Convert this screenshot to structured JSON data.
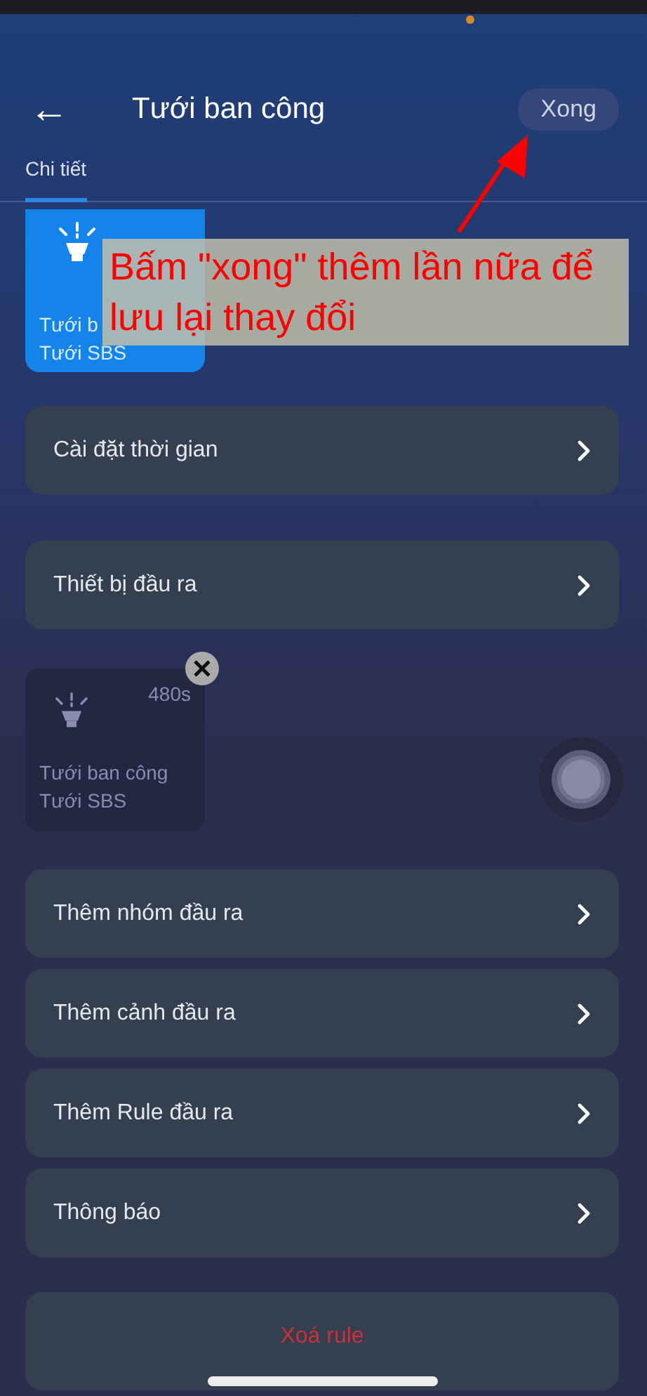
{
  "header": {
    "back": "←",
    "title": "Tưới ban công",
    "done_button": "Xong"
  },
  "tabs": [
    {
      "label": "Chi tiết",
      "selected": true
    }
  ],
  "selected_device": {
    "name": "Tưới b",
    "group": "Tưới SBS"
  },
  "rows": [
    {
      "label": "Cài đặt thời gian"
    },
    {
      "label": "Thiết bị đầu ra"
    }
  ],
  "output_device": {
    "duration": "480s",
    "name": "Tưới ban công",
    "group": "Tưới SBS"
  },
  "more_rows": [
    {
      "label": "Thêm nhóm đầu ra"
    },
    {
      "label": "Thêm cảnh đầu ra"
    },
    {
      "label": "Thêm Rule đầu ra"
    },
    {
      "label": "Thông báo"
    }
  ],
  "delete_button": "Xoá rule",
  "annotation": "Bấm \"xong\" thêm lần nữa để lưu lại thay đổi"
}
